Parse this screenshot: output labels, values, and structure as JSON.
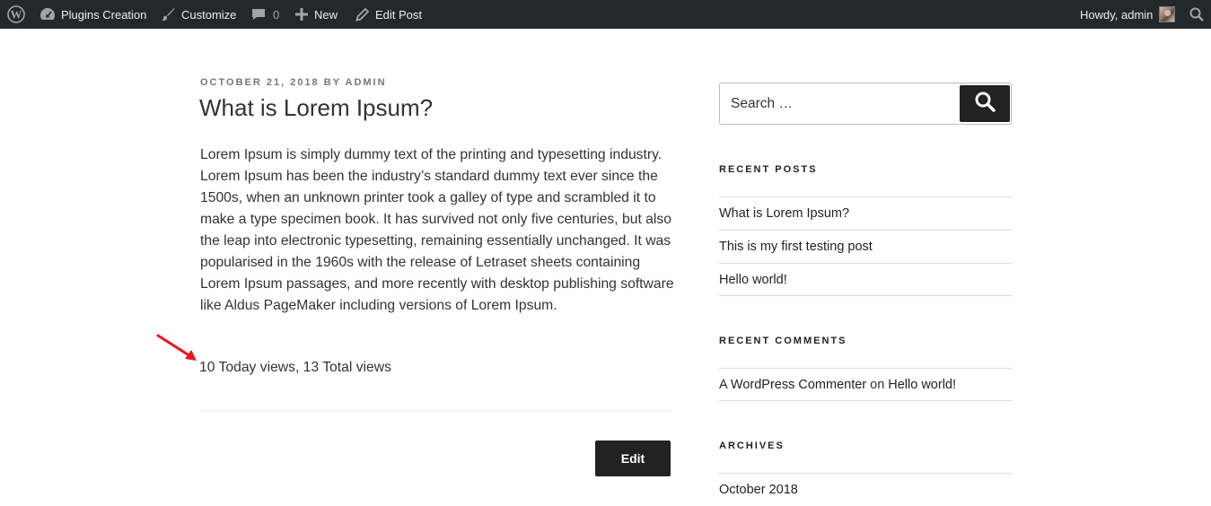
{
  "adminbar": {
    "site_name": "Plugins Creation",
    "customize": "Customize",
    "comments_count": "0",
    "new": "New",
    "edit_post": "Edit Post",
    "howdy": "Howdy, admin",
    "bg_color": "#23282d"
  },
  "post": {
    "date": "October 21, 2018",
    "by": "by",
    "author": "admin",
    "title": "What is Lorem Ipsum?",
    "body": "Lorem Ipsum is simply dummy text of the printing and typesetting industry. Lorem Ipsum has been the industry’s standard dummy text ever since the 1500s, when an unknown printer took a galley of type and scrambled it to make a type specimen book. It has survived not only five centuries, but also the leap into electronic typesetting, remaining essentially unchanged. It was popularised in the 1960s with the release of Letraset sheets containing Lorem Ipsum passages, and more recently with desktop publishing software like Aldus PageMaker including versions of Lorem Ipsum.",
    "views": "10 Today views, 13 Total views",
    "edit_label": "Edit",
    "arrow_color": "#e8171b"
  },
  "sidebar": {
    "search_placeholder": "Search …",
    "recent_posts_title": "Recent Posts",
    "recent_posts": [
      "What is Lorem Ipsum?",
      "This is my first testing post",
      "Hello world!"
    ],
    "recent_comments_title": "Recent Comments",
    "comment": {
      "author": "A WordPress Commenter",
      "on": "on",
      "post": "Hello world!"
    },
    "archives_title": "Archives",
    "archives": [
      "October 2018"
    ]
  }
}
